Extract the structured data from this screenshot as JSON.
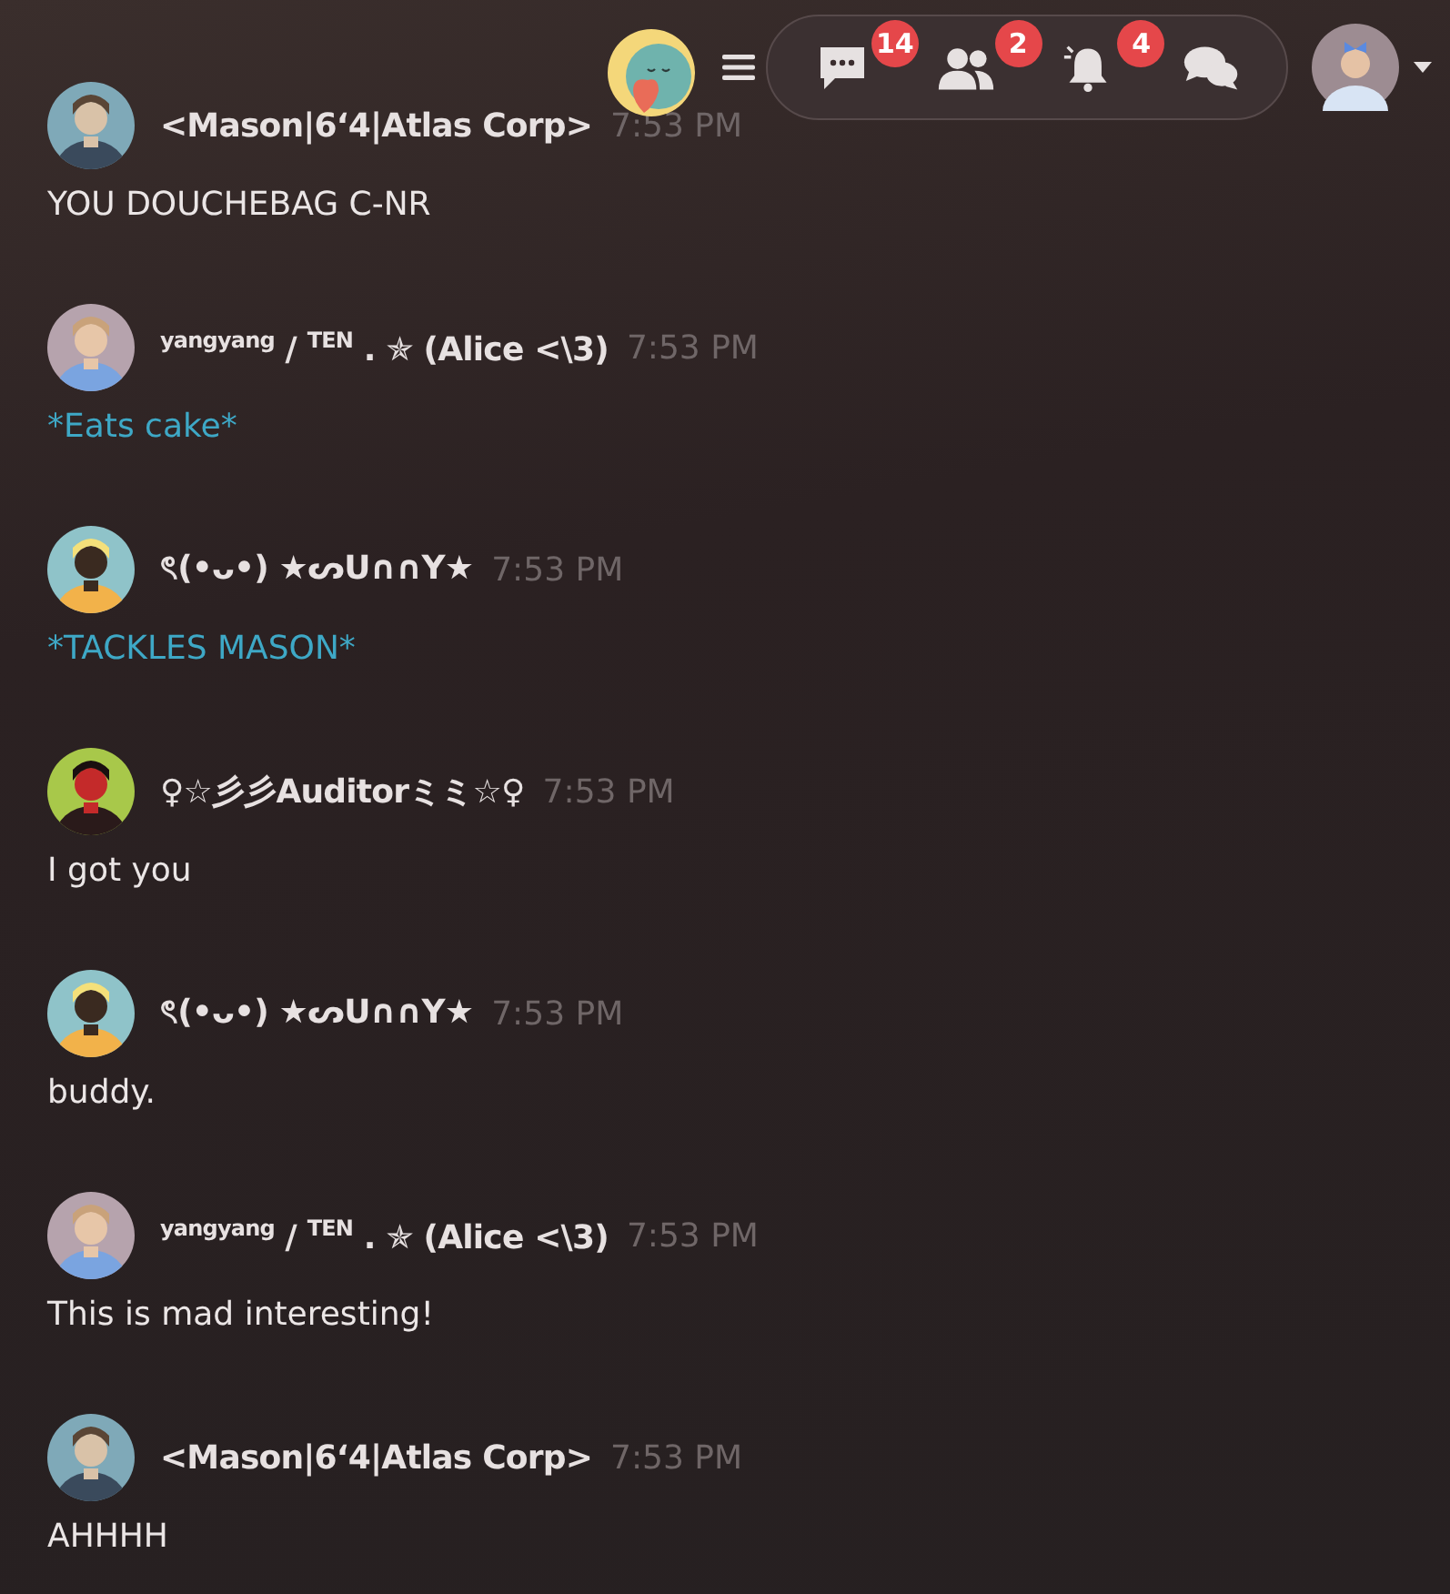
{
  "top_bar": {
    "badges": [
      {
        "kind": "messages",
        "count": "14"
      },
      {
        "kind": "friends",
        "count": "2"
      },
      {
        "kind": "notifications",
        "count": "4"
      },
      {
        "kind": "chats"
      }
    ]
  },
  "messages": [
    {
      "author": "<Mason|6‘4|Atlas Corp>",
      "time": "7:53 PM",
      "text": "YOU DOUCHEBAG C-NR",
      "kind": "plain"
    },
    {
      "author": "$^{yangyang}$ / $^{TEN}$ . ✯ (Alice <\\3)",
      "time": "7:53 PM",
      "text": "*Eats cake*",
      "kind": "action"
    },
    {
      "author": "ৎ(•ᴗ•) ★ᔕU∩∩Y★",
      "time": "7:53 PM",
      "text": "*TACKLES MASON*",
      "kind": "action"
    },
    {
      "author": "♀☆彡彡Auditorミミ☆♀",
      "time": "7:53 PM",
      "text": "I got you",
      "kind": "plain"
    },
    {
      "author": "ৎ(•ᴗ•) ★ᔕU∩∩Y★",
      "time": "7:53 PM",
      "text": "buddy.",
      "kind": "plain"
    },
    {
      "author": "$^{yangyang}$ / $^{TEN}$ . ✯ (Alice <\\3)",
      "time": "7:53 PM",
      "text": "This is mad interesting!",
      "kind": "plain"
    },
    {
      "author": "<Mason|6‘4|Atlas Corp>",
      "time": "7:53 PM",
      "text": "AHHHH",
      "kind": "plain"
    }
  ]
}
